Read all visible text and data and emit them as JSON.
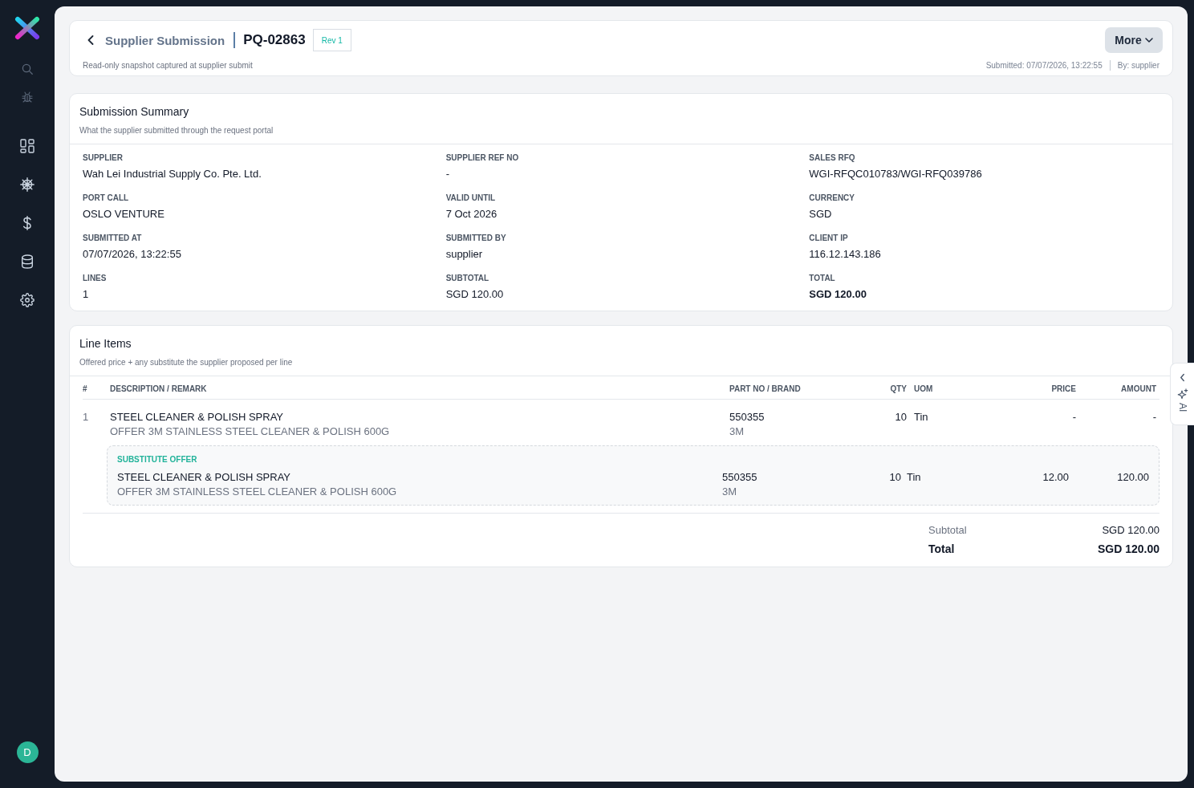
{
  "sidebar": {
    "avatar": "D"
  },
  "header": {
    "breadcrumb": "Supplier Submission",
    "title": "PQ-02863",
    "badge": "Rev 1",
    "subtitle": "Read-only snapshot captured at supplier submit",
    "more_button": "More",
    "submitted": "Submitted: 07/07/2026, 13:22:55",
    "submitted_by": "By: supplier"
  },
  "summary": {
    "title": "Submission Summary",
    "subtitle": "What the supplier submitted through the request portal",
    "fields": [
      {
        "label": "SUPPLIER",
        "value": "Wah Lei Industrial Supply Co. Pte. Ltd.",
        "strong": false
      },
      {
        "label": "SUPPLIER REF NO",
        "value": "-",
        "strong": false
      },
      {
        "label": "SALES RFQ",
        "value": "WGI-RFQC010783/WGI-RFQ039786",
        "strong": false
      },
      {
        "label": "PORT CALL",
        "value": "OSLO VENTURE",
        "strong": false
      },
      {
        "label": "VALID UNTIL",
        "value": "7 Oct 2026",
        "strong": false
      },
      {
        "label": "CURRENCY",
        "value": "SGD",
        "strong": false
      },
      {
        "label": "SUBMITTED AT",
        "value": "07/07/2026, 13:22:55",
        "strong": false
      },
      {
        "label": "SUBMITTED BY",
        "value": "supplier",
        "strong": false
      },
      {
        "label": "CLIENT IP",
        "value": "116.12.143.186",
        "strong": false
      },
      {
        "label": "LINES",
        "value": "1",
        "strong": false
      },
      {
        "label": "SUBTOTAL",
        "value": "SGD 120.00",
        "strong": false
      },
      {
        "label": "TOTAL",
        "value": "SGD 120.00",
        "strong": true
      }
    ]
  },
  "line_items": {
    "title": "Line Items",
    "subtitle": "Offered price + any substitute the supplier proposed per line",
    "columns": [
      "#",
      "DESCRIPTION / REMARK",
      "PART NO / BRAND",
      "QTY",
      "UOM",
      "PRICE",
      "AMOUNT"
    ],
    "rows": [
      {
        "number": "1",
        "description": "STEEL CLEANER & POLISH SPRAY",
        "remark": "OFFER 3M STAINLESS STEEL CLEANER & POLISH 600G",
        "part_no": "550355",
        "brand": "3M",
        "qty": "10",
        "uom": "Tin",
        "price": "-",
        "amount": "-",
        "substitute": {
          "label": "SUBSTITUTE OFFER",
          "description": "STEEL CLEANER & POLISH SPRAY",
          "remark": "OFFER 3M STAINLESS STEEL CLEANER & POLISH 600G",
          "part_no": "550355",
          "brand": "3M",
          "qty": "10",
          "uom": "Tin",
          "price": "12.00",
          "amount": "120.00"
        }
      }
    ],
    "totals": [
      {
        "label": "Subtotal",
        "value": "SGD 120.00",
        "strong": false
      },
      {
        "label": "Total",
        "value": "SGD 120.00",
        "strong": true
      }
    ]
  },
  "ai_tab": {
    "label": "AI"
  }
}
